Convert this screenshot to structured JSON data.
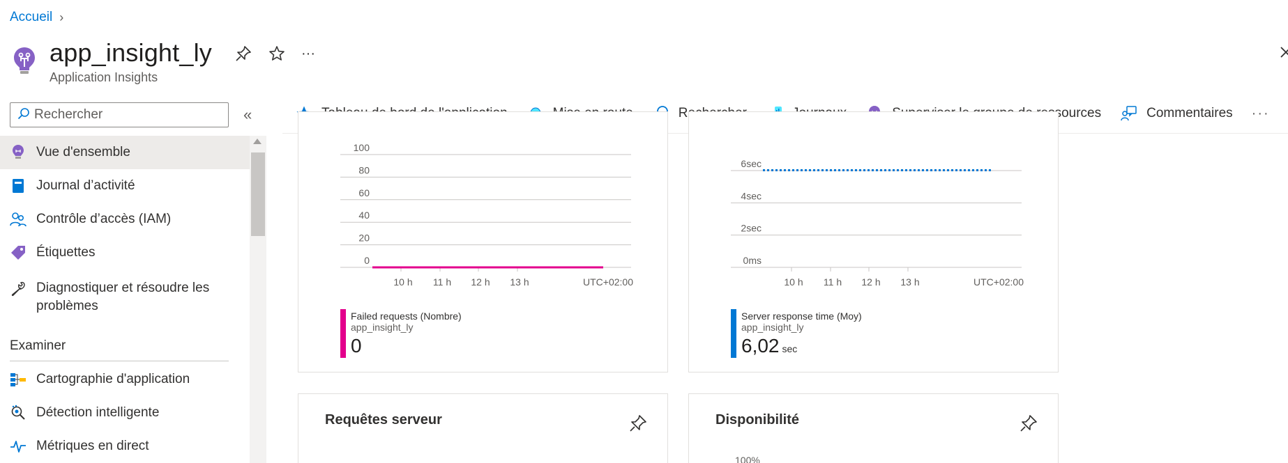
{
  "breadcrumb": {
    "home": "Accueil"
  },
  "header": {
    "title": "app_insight_ly",
    "subtitle": "Application Insights"
  },
  "search": {
    "placeholder": "Rechercher"
  },
  "nav": {
    "items": [
      {
        "label": "Vue d'ensemble",
        "icon": "lightbulb-icon"
      },
      {
        "label": "Journal d’activité",
        "icon": "log-icon"
      },
      {
        "label": "Contrôle d’accès (IAM)",
        "icon": "people-icon"
      },
      {
        "label": "Étiquettes",
        "icon": "tag-icon"
      },
      {
        "label": "Diagnostiquer et résoudre les problèmes",
        "icon": "wrench-icon"
      }
    ],
    "section": "Examiner",
    "items2": [
      {
        "label": "Cartographie d'application",
        "icon": "app-map-icon"
      },
      {
        "label": "Détection intelligente",
        "icon": "smart-detection-icon"
      },
      {
        "label": "Métriques en direct",
        "icon": "pulse-icon"
      }
    ]
  },
  "toolbar": {
    "dashboard": "Tableau de bord de l'application",
    "getting_started": "Mise en route",
    "search": "Rechercher",
    "logs": "Journaux",
    "monitor_rg": "Superviser le groupe de ressources",
    "feedback": "Commentaires",
    "more": "···"
  },
  "colors": {
    "accent": "#0078d4",
    "failed": "#e3008c",
    "response": "#0078d4",
    "purple": "#8661c5"
  },
  "cards": {
    "failed": {
      "legend_name": "Failed requests (Nombre)",
      "legend_resource": "app_insight_ly",
      "legend_value": "0",
      "timezone": "UTC+02:00"
    },
    "response": {
      "legend_name": "Server response time (Moy)",
      "legend_resource": "app_insight_ly",
      "legend_value": "6,02",
      "legend_unit": "sec",
      "timezone": "UTC+02:00"
    },
    "server_requests": {
      "title": "Requêtes serveur"
    },
    "availability": {
      "title": "Disponibilité",
      "first_tick": "100%"
    }
  },
  "chart_data": [
    {
      "type": "line",
      "x": [
        "10 h",
        "11 h",
        "12 h",
        "13 h"
      ],
      "yticks": [
        "100",
        "80",
        "60",
        "40",
        "20",
        "0"
      ],
      "ylim": [
        0,
        100
      ],
      "series": [
        {
          "name": "Failed requests (Nombre)",
          "values": [
            0,
            0,
            0,
            0
          ]
        }
      ],
      "color": "#e3008c"
    },
    {
      "type": "line",
      "x": [
        "10 h",
        "11 h",
        "12 h",
        "13 h"
      ],
      "yticks": [
        "6sec",
        "4sec",
        "2sec",
        "0ms"
      ],
      "ylim": [
        0,
        6
      ],
      "series": [
        {
          "name": "Server response time (Moy)",
          "values": [
            6.02,
            6.02,
            6.02,
            6.02
          ]
        }
      ],
      "color": "#0078d4"
    }
  ]
}
